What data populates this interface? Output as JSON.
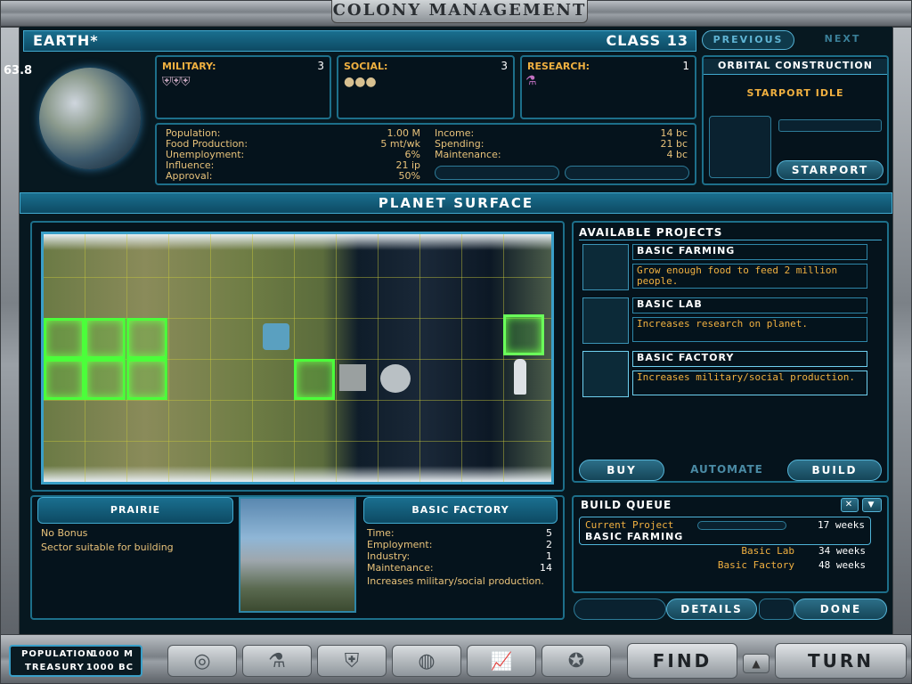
{
  "header": {
    "title": "Colony Management"
  },
  "fps": "63.8",
  "planet": {
    "name": "Earth*",
    "class_label": "Class 13",
    "previous": "Previous",
    "next": "Next"
  },
  "stats": {
    "military": {
      "label": "Military:",
      "value": "3"
    },
    "social": {
      "label": "Social:",
      "value": "3"
    },
    "research": {
      "label": "Research:",
      "value": "1"
    }
  },
  "economy": {
    "left": [
      {
        "label": "Population:",
        "value": "1.00 M"
      },
      {
        "label": "Food Production:",
        "value": "5 mt/wk"
      },
      {
        "label": "Unemployment:",
        "value": "6%"
      },
      {
        "label": "Influence:",
        "value": "21 ip"
      },
      {
        "label": "Approval:",
        "value": "50%"
      }
    ],
    "right": [
      {
        "label": "Income:",
        "value": "14 bc"
      },
      {
        "label": "Spending:",
        "value": "21 bc"
      },
      {
        "label": "Maintenance:",
        "value": "4 bc"
      }
    ]
  },
  "orbital": {
    "title": "Orbital Construction",
    "status": "Starport Idle",
    "button": "Starport"
  },
  "surface": {
    "title": "Planet Surface"
  },
  "projects": {
    "title": "Available Projects",
    "items": [
      {
        "name": "Basic Farming",
        "desc": "Grow enough food to feed 2 million people."
      },
      {
        "name": "Basic Lab",
        "desc": "Increases research on planet."
      },
      {
        "name": "Basic Factory",
        "desc": "Increases military/social production."
      }
    ],
    "buy": "Buy",
    "automate": "Automate",
    "build": "Build"
  },
  "tile_info": {
    "title": "Prairie",
    "bonus": "No Bonus",
    "desc": "Sector suitable for building"
  },
  "selected": {
    "title": "Basic Factory",
    "rows": [
      {
        "label": "Time:",
        "value": "5"
      },
      {
        "label": "Employment:",
        "value": "2"
      },
      {
        "label": "Industry:",
        "value": "1"
      },
      {
        "label": "Maintenance:",
        "value": "14"
      }
    ],
    "desc": "Increases military/social production."
  },
  "queue": {
    "title": "Build Queue",
    "current_label": "Current Project",
    "current_name": "Basic Farming",
    "current_time": "17 weeks",
    "items": [
      {
        "name": "Basic Lab",
        "time": "34 weeks"
      },
      {
        "name": "Basic Factory",
        "time": "48 weeks"
      }
    ]
  },
  "footer": {
    "details": "Details",
    "done": "Done",
    "population_label": "Population",
    "population_value": "1000 M",
    "treasury_label": "Treasury",
    "treasury_value": "1000 bc",
    "find": "Find",
    "turn": "Turn"
  },
  "icons": [
    "galaxy-icon",
    "research-flask-icon",
    "government-icon",
    "planets-icon",
    "graph-icon",
    "diplomacy-icon"
  ],
  "colors": {
    "accent": "#1d6f8a",
    "gold": "#f0b040",
    "highlight": "#4bff3a"
  }
}
